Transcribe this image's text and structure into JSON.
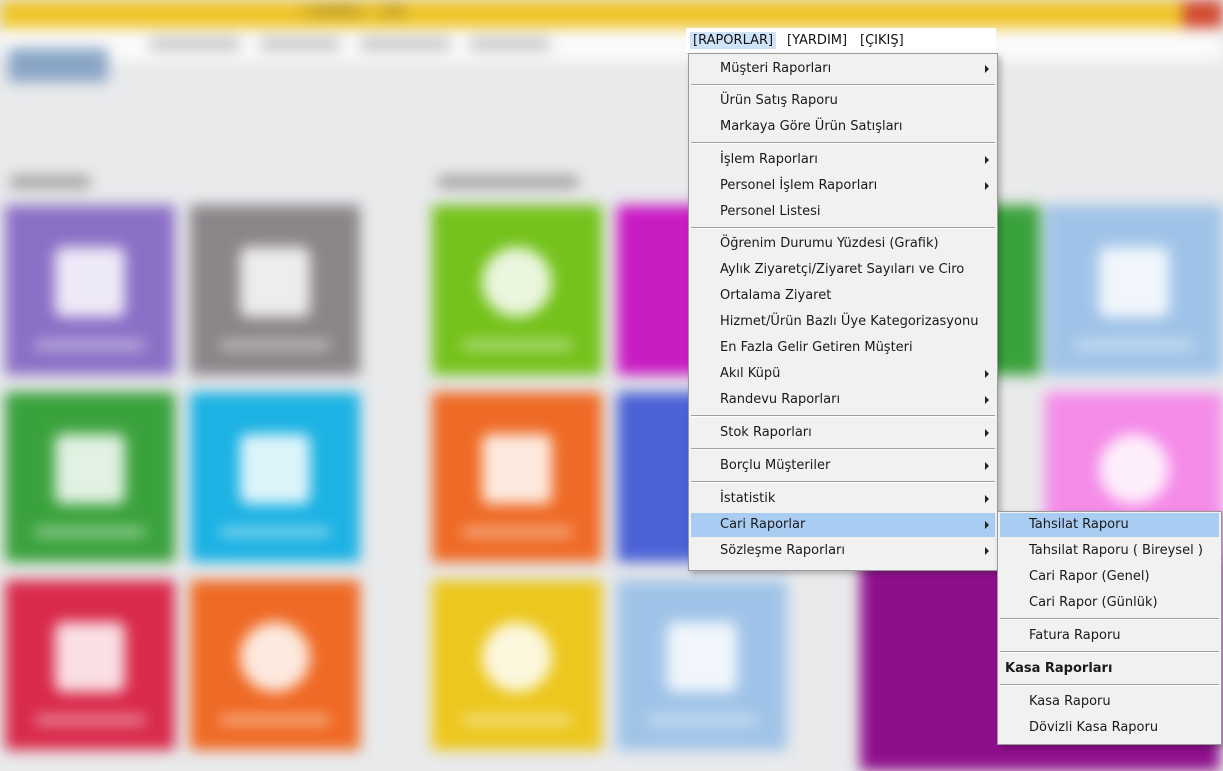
{
  "window": {
    "title": "( ADMIN ) - [AR"
  },
  "menubar": {
    "items": [
      "[RAPORLAR]",
      "[YARDIM]",
      "[ÇIKIŞ]"
    ]
  },
  "reports_menu": {
    "items": [
      {
        "label": "Müşteri Raporları",
        "submenu": true
      },
      {
        "label": "Ürün Satış Raporu",
        "submenu": false
      },
      {
        "label": "Markaya Göre Ürün Satışları",
        "submenu": false
      },
      {
        "label": "İşlem Raporları",
        "submenu": true
      },
      {
        "label": "Personel İşlem Raporları",
        "submenu": true
      },
      {
        "label": "Personel Listesi",
        "submenu": false
      },
      {
        "label": "Öğrenim Durumu Yüzdesi (Grafik)",
        "submenu": false
      },
      {
        "label": "Aylık Ziyaretçi/Ziyaret Sayıları ve Ciro",
        "submenu": false
      },
      {
        "label": "Ortalama Ziyaret",
        "submenu": false
      },
      {
        "label": "Hizmet/Ürün Bazlı Üye Kategorizasyonu",
        "submenu": false
      },
      {
        "label": "En Fazla Gelir Getiren Müşteri",
        "submenu": false
      },
      {
        "label": "Akıl Küpü",
        "submenu": true
      },
      {
        "label": "Randevu Raporları",
        "submenu": true
      },
      {
        "label": "Stok Raporları",
        "submenu": true
      },
      {
        "label": "Borçlu Müşteriler",
        "submenu": true
      },
      {
        "label": "İstatistik",
        "submenu": true
      },
      {
        "label": "Cari Raporlar",
        "submenu": true
      },
      {
        "label": "Sözleşme Raporları",
        "submenu": true
      }
    ]
  },
  "cari_submenu": {
    "items": [
      {
        "label": "Tahsilat Raporu"
      },
      {
        "label": "Tahsilat Raporu ( Bireysel )"
      },
      {
        "label": "Cari Rapor (Genel)"
      },
      {
        "label": "Cari Rapor (Günlük)"
      },
      {
        "label": "Fatura Raporu"
      },
      {
        "label": "Kasa Raporları"
      },
      {
        "label": "Kasa Raporu"
      },
      {
        "label": "Dövizli Kasa Raporu"
      }
    ]
  },
  "colors": {
    "title_bar": "#efc52a",
    "menu_highlight": "#a9cdf2",
    "menu_background": "#f1f1f1",
    "tile_purple": "#8b6fc6",
    "tile_gray": "#8a8589",
    "tile_green": "#3aa23c",
    "tile_cyan": "#1cb2e3",
    "tile_red": "#d92a4b",
    "tile_orange": "#ef6a25",
    "tile_lime": "#74c21b",
    "tile_magenta": "#c81cc3",
    "tile_yellow": "#ecc71d",
    "tile_lightblue": "#9fc3e8",
    "tile_darkpurple": "#8e0f8c",
    "tile_pink": "#f58ce8"
  }
}
